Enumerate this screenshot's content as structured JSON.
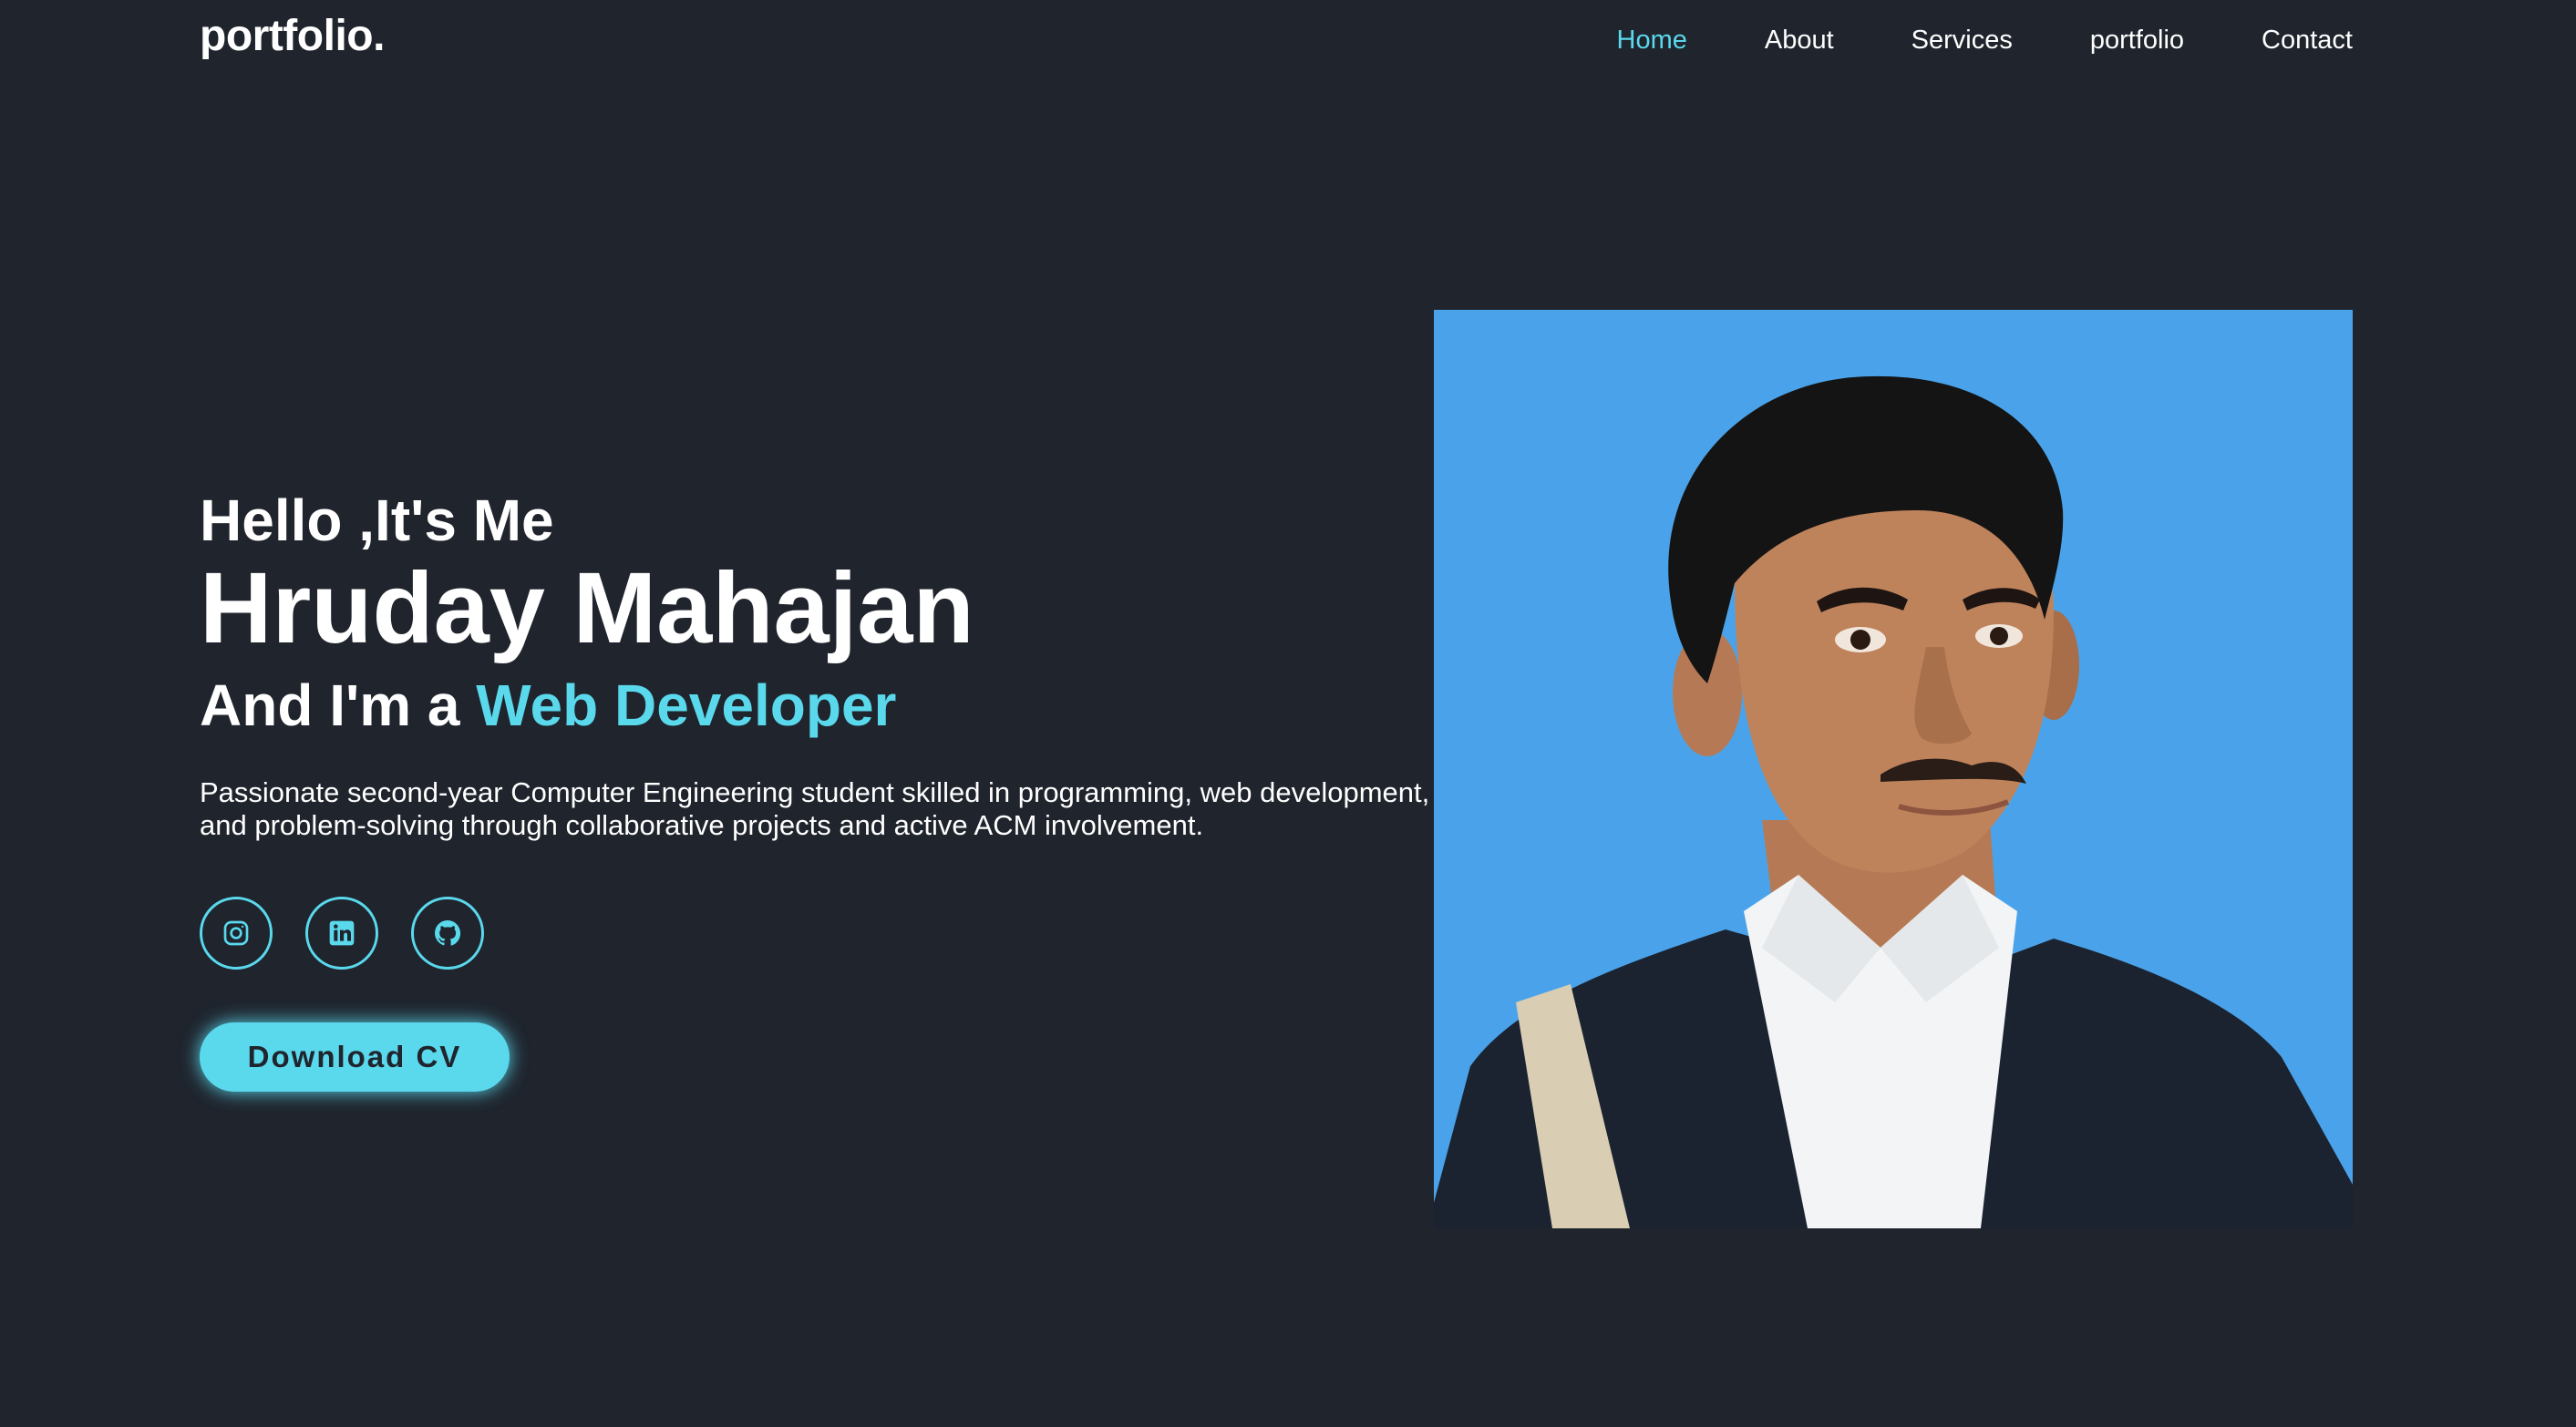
{
  "header": {
    "logo": "portfolio.",
    "nav": [
      {
        "label": "Home",
        "active": true
      },
      {
        "label": "About",
        "active": false
      },
      {
        "label": "Services",
        "active": false
      },
      {
        "label": "portfolio",
        "active": false
      },
      {
        "label": "Contact",
        "active": false
      }
    ]
  },
  "hero": {
    "greeting": "Hello ,It's Me",
    "name": "Hruday Mahajan",
    "role_prefix": "And I'm a ",
    "role_highlight": "Web Developer",
    "description": "Passionate second-year Computer Engineering student skilled in programming, web development, and problem-solving through collaborative projects and active ACM involvement.",
    "social": [
      {
        "icon": "instagram-icon"
      },
      {
        "icon": "linkedin-icon"
      },
      {
        "icon": "github-icon"
      }
    ],
    "cta_label": "Download CV"
  },
  "colors": {
    "background": "#1f242d",
    "accent": "#5ad8ec",
    "photo_background": "#4aa3ea"
  }
}
